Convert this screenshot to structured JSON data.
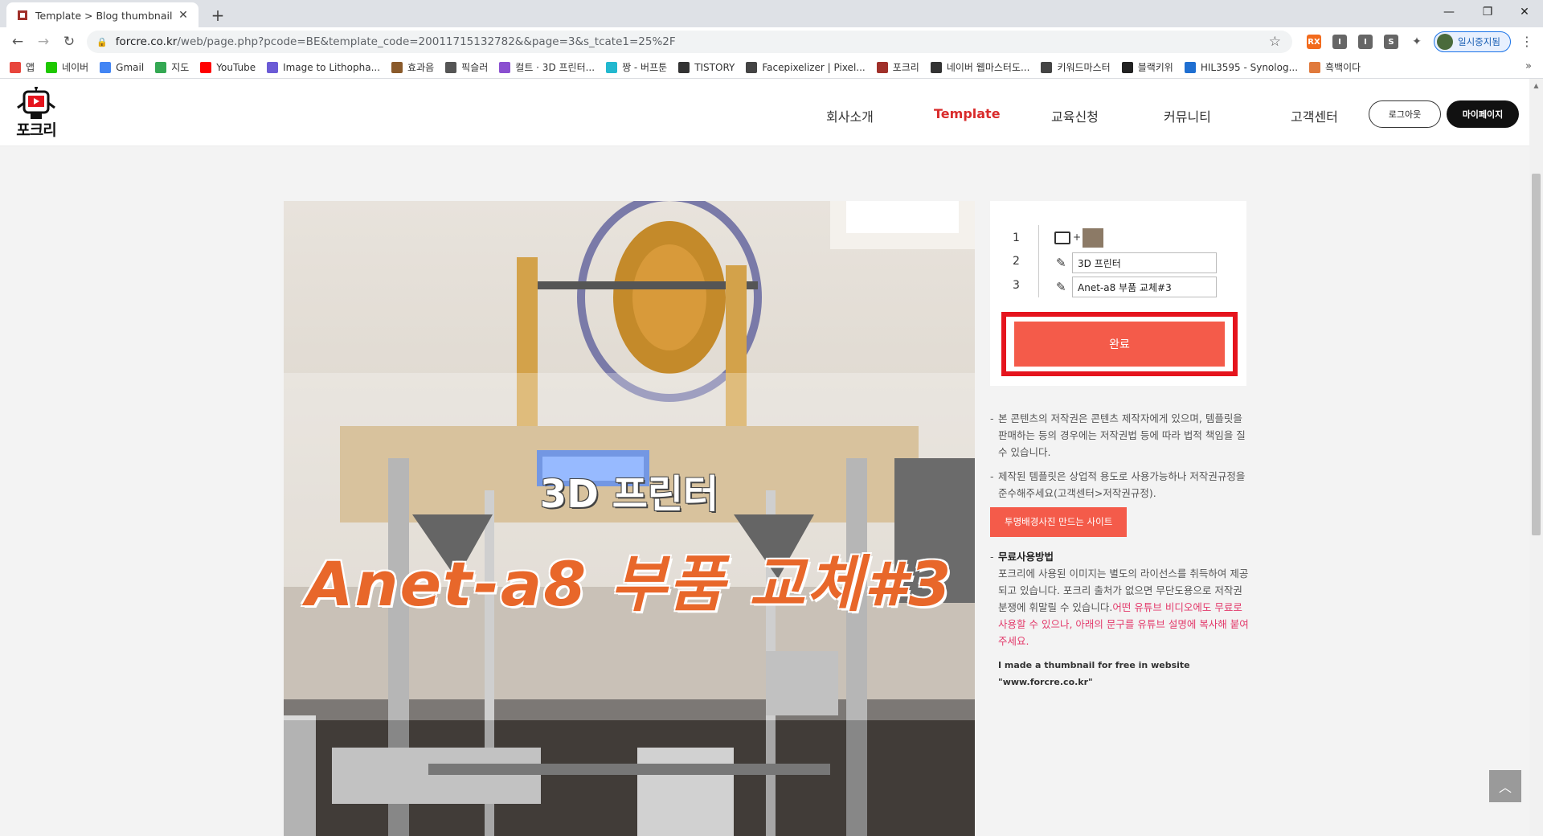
{
  "browser": {
    "tab_title": "Template > Blog thumbnail | 포",
    "url_host": "forcre.co.kr",
    "url_rest": "/web/page.php?pcode=BE&template_code=20011715132782&&page=3&s_tcate1=25%2F",
    "profile_label": "일시중지됨",
    "window_controls": [
      "—",
      "❐",
      "✕"
    ],
    "bookmarks": [
      {
        "label": "앱",
        "icon": "apps-icon",
        "color": "#e8453c"
      },
      {
        "label": "네이버",
        "icon": "naver-icon",
        "color": "#1ec800"
      },
      {
        "label": "Gmail",
        "icon": "google-icon",
        "color": "#4285f4"
      },
      {
        "label": "지도",
        "icon": "maps-icon",
        "color": "#34a853"
      },
      {
        "label": "YouTube",
        "icon": "youtube-icon",
        "color": "#ff0000"
      },
      {
        "label": "Image to Lithopha...",
        "icon": "litho-icon",
        "color": "#6b5bd6"
      },
      {
        "label": "효과음",
        "icon": "sound-icon",
        "color": "#8a5a2b"
      },
      {
        "label": "픽슬러",
        "icon": "pixlr-icon",
        "color": "#555555"
      },
      {
        "label": "컬트 · 3D 프린터...",
        "icon": "cults-icon",
        "color": "#8a4fd0"
      },
      {
        "label": "짱 - 버프툰",
        "icon": "bufftoon-icon",
        "color": "#22b8cf"
      },
      {
        "label": "TISTORY",
        "icon": "tistory-icon",
        "color": "#333333"
      },
      {
        "label": "Facepixelizer | Pixel...",
        "icon": "facepix-icon",
        "color": "#444444"
      },
      {
        "label": "포크리",
        "icon": "forcre-icon",
        "color": "#a0302a"
      },
      {
        "label": "네이버 웹마스터도...",
        "icon": "webmaster-icon",
        "color": "#333333"
      },
      {
        "label": "키워드마스터",
        "icon": "keyword-icon",
        "color": "#444444"
      },
      {
        "label": "블랙키위",
        "icon": "blackkiwi-icon",
        "color": "#222222"
      },
      {
        "label": "HIL3595 - Synolog...",
        "icon": "dsm-icon",
        "color": "#1f6fd1"
      },
      {
        "label": "흑백이다",
        "icon": "bw-icon",
        "color": "#e07a3c"
      }
    ]
  },
  "site": {
    "logo_text": "포크리",
    "nav": [
      {
        "label": "회사소개",
        "active": false
      },
      {
        "label": "Template",
        "active": true
      },
      {
        "label": "교육신청",
        "active": false
      },
      {
        "label": "커뮤니티",
        "active": false
      },
      {
        "label": "고객센터",
        "active": false
      }
    ],
    "logout_label": "로그아웃",
    "mypage_label": "마이페이지",
    "accent_color": "#d92b2b"
  },
  "thumbnail": {
    "line1": "3D 프린터",
    "line2": "Anet-a8 부품 교체#3",
    "line2_color": "#e8672a"
  },
  "editor": {
    "row_numbers": [
      "1",
      "2",
      "3"
    ],
    "field2_value": "3D 프린터",
    "field3_value": "Anet-a8 부품 교체#3",
    "done_label": "완료",
    "done_color": "#f45b4a",
    "highlight_color": "#e5141d"
  },
  "notes": {
    "copyright": "본 콘텐츠의 저작권은 콘텐츠 제작자에게 있으며, 템플릿을 판매하는 등의 경우에는 저작권법 등에 따라 법적 책임을 질 수 있습니다.",
    "commercial": "제작된 템플릿은 상업적 용도로 사용가능하나 저작권규정을 준수해주세요(고객센터>저작권규정).",
    "transparent_site_label": "투명배경사진 만드는 사이트",
    "free_title": "무료사용방법",
    "free_body": "포크리에 사용된 이미지는 별도의 라이선스를 취득하여 제공되고 있습니다. 포크리 출처가 없으면 무단도용으로 저작권 분쟁에 휘말릴 수 있습니다.",
    "free_red": "어떤 유튜브 비디오에도 무료로 사용할 수 있으나, 아래의 문구를 유튜브 설명에 복사해 붙여주세요.",
    "credit": "I made a thumbnail for free in website \"www.forcre.co.kr\""
  }
}
